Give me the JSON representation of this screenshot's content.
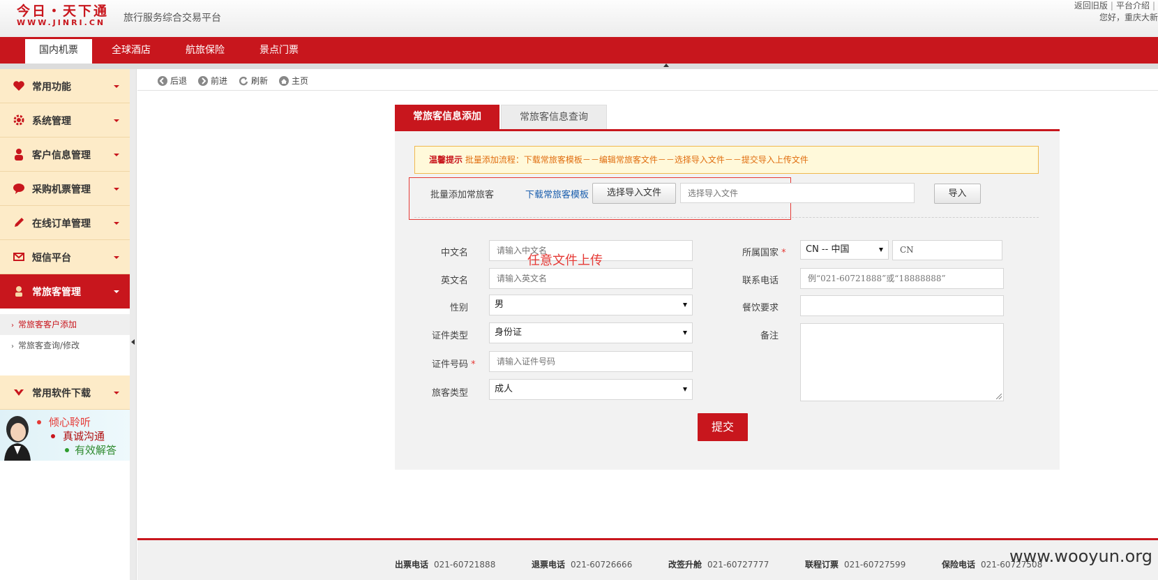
{
  "header": {
    "logo_cn": "今日・天下通",
    "logo_en": "WWW.JINRI.CN",
    "slogan": "旅行服务综合交易平台",
    "top_links": [
      "返回旧版",
      "平台介绍"
    ],
    "greeting": "您好，重庆大新"
  },
  "nav": {
    "tabs": [
      "国内机票",
      "全球酒店",
      "航旅保险",
      "景点门票"
    ],
    "active": "国内机票"
  },
  "sidebar": {
    "menus": [
      {
        "label": "常用功能",
        "icon": "heart-icon"
      },
      {
        "label": "系统管理",
        "icon": "gear-icon"
      },
      {
        "label": "客户信息管理",
        "icon": "person-icon"
      },
      {
        "label": "采购机票管理",
        "icon": "chat-bubble-icon"
      },
      {
        "label": "在线订单管理",
        "icon": "pencil-icon"
      },
      {
        "label": "短信平台",
        "icon": "envelope-icon"
      },
      {
        "label": "常旅客管理",
        "icon": "traveler-icon"
      }
    ],
    "submenu": [
      "常旅客客户添加",
      "常旅客查询/修改"
    ],
    "download": {
      "label": "常用软件下载",
      "icon": "download-icon"
    },
    "banner": [
      "倾心聆听",
      "真诚沟通",
      "有效解答"
    ]
  },
  "toolbar": {
    "back": "后退",
    "forward": "前进",
    "refresh": "刷新",
    "home": "主页"
  },
  "panel": {
    "tabs": [
      "常旅客信息添加",
      "常旅客信息查询"
    ],
    "tip_title": "温馨提示",
    "tip_text": "批量添加流程：下载常旅客模板－－编辑常旅客文件－－选择导入文件－－提交导入上传文件",
    "batch": {
      "label": "批量添加常旅客",
      "download_link": "下载常旅客模板",
      "choose_button": "选择导入文件",
      "file_placeholder": "选择导入文件",
      "import_button": "导入"
    },
    "overlay_note": "任意文件上传",
    "form": {
      "chinese_name_label": "中文名",
      "chinese_name_placeholder": "请输入中文名",
      "english_name_label": "英文名",
      "english_name_placeholder": "请输入英文名",
      "gender_label": "性别",
      "gender_value": "男",
      "id_type_label": "证件类型",
      "id_type_value": "身份证",
      "id_number_label": "证件号码",
      "id_number_placeholder": "请输入证件号码",
      "traveler_type_label": "旅客类型",
      "traveler_type_value": "成人",
      "country_label": "所属国家",
      "country_value": "CN -- 中国",
      "country_code": "CN",
      "phone_label": "联系电话",
      "phone_placeholder": "例“021-60721888”或“18888888”",
      "meal_label": "餐饮要求",
      "remark_label": "备注",
      "required_mark": "*"
    },
    "submit_label": "提交"
  },
  "footer": {
    "items": [
      {
        "label": "出票电话",
        "value": "021-60721888"
      },
      {
        "label": "退票电话",
        "value": "021-60726666"
      },
      {
        "label": "改签升舱",
        "value": "021-60727777"
      },
      {
        "label": "联程订票",
        "value": "021-60727599"
      },
      {
        "label": "保险电话",
        "value": "021-60727508"
      }
    ]
  },
  "watermark": "www.wooyun.org",
  "colors": {
    "brand_red": "#c8161d",
    "sidebar_bg": "#fdebc8",
    "tip_border": "#f0b84e",
    "link_blue": "#1b5fae"
  }
}
